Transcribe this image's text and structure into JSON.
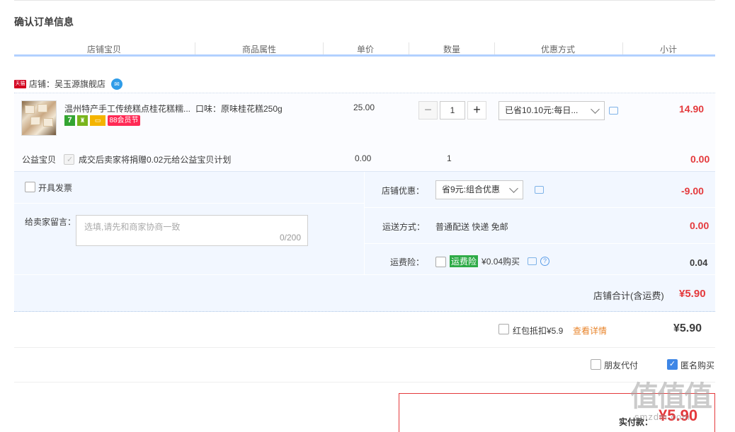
{
  "section_title": "确认订单信息",
  "columns": [
    "店铺宝贝",
    "商品属性",
    "单价",
    "数量",
    "优惠方式",
    "小计"
  ],
  "shop": {
    "badge": "天猫",
    "label": "店铺：吴玉源旗舰店"
  },
  "item": {
    "title": "温州特产手工传统糕点桂花糕糯...",
    "attr": "口味：原味桂花糕250g",
    "tags": [
      "7",
      "88会员节"
    ],
    "unit_price": "25.00",
    "quantity": "1",
    "minus": "−",
    "plus": "+",
    "promo": "已省10.10元:每日...",
    "subtotal": "14.90"
  },
  "charity": {
    "label": "公益宝贝",
    "text": "成交后卖家将捐赠0.02元给公益宝贝计划",
    "price": "0.00",
    "quantity": "1",
    "subtotal": "0.00"
  },
  "invoice": {
    "label": "开具发票"
  },
  "message": {
    "label": "给卖家留言：",
    "placeholder": "选填,请先和商家协商一致",
    "count": "0/200"
  },
  "shop_discount": {
    "label": "店铺优惠：",
    "value": "省9元:组合优惠",
    "amount": "-9.00"
  },
  "shipping": {
    "label": "运送方式：",
    "value": "普通配送 快递 免邮",
    "amount": "0.00"
  },
  "insurance": {
    "label": "运费险：",
    "tag": "运费险",
    "text": "¥0.04购买",
    "amount": "0.04"
  },
  "shop_total": {
    "label": "店铺合计(含运费)",
    "amount": "¥5.90"
  },
  "red_packet": {
    "label": "红包抵扣¥5.9",
    "link": "查看详情",
    "amount": "¥5.90"
  },
  "friend_pay": {
    "label": "朋友代付"
  },
  "anonymous": {
    "label": "匿名购买"
  },
  "pay": {
    "label": "实付款：",
    "amount": "¥5.90"
  },
  "watermark": {
    "text": "值值值",
    "url": "smzdm.com"
  },
  "colors": {
    "accent_red": "#e4393c",
    "header_line": "#b2d1ff",
    "panel_bg": "#f2f7ff",
    "link_orange": "#e8842b",
    "checkbox_blue": "#3e86e6"
  }
}
